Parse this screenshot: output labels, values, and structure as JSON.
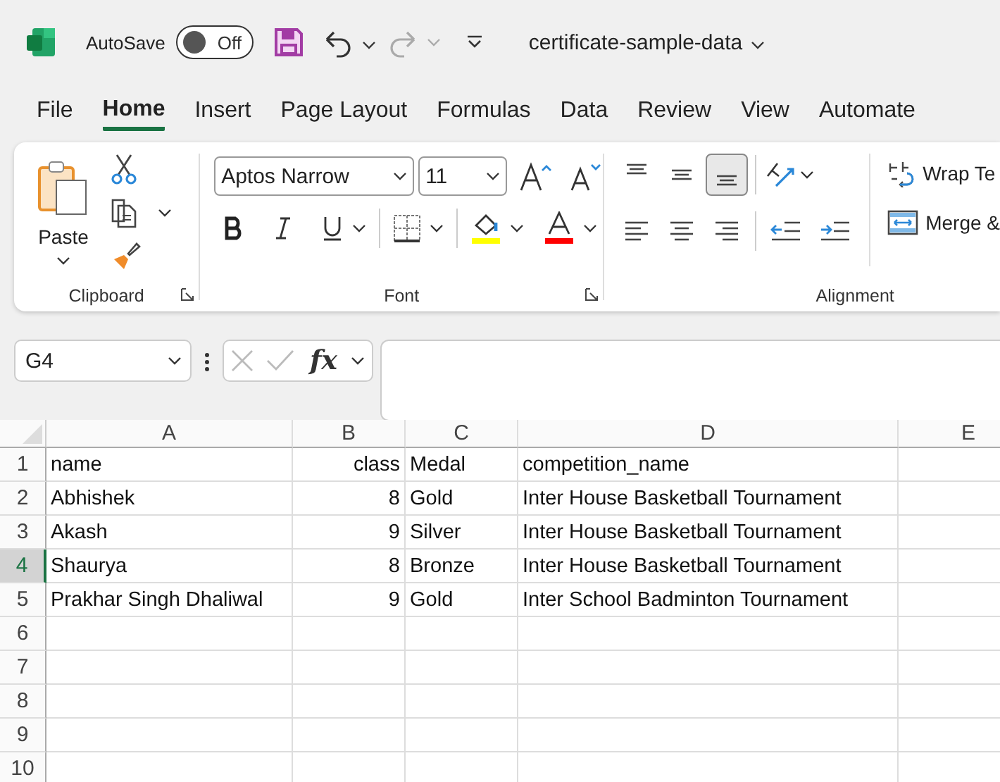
{
  "title_bar": {
    "autosave": {
      "label": "AutoSave",
      "on": false,
      "state_label": "Off"
    },
    "undo": {
      "disabled": false
    },
    "redo": {
      "disabled": true
    },
    "file_name": "certificate-sample-data"
  },
  "tabs": [
    {
      "label": "File",
      "selected": false
    },
    {
      "label": "Home",
      "selected": true
    },
    {
      "label": "Insert",
      "selected": false
    },
    {
      "label": "Page Layout",
      "selected": false
    },
    {
      "label": "Formulas",
      "selected": false
    },
    {
      "label": "Data",
      "selected": false
    },
    {
      "label": "Review",
      "selected": false
    },
    {
      "label": "View",
      "selected": false
    },
    {
      "label": "Automate",
      "selected": false
    }
  ],
  "ribbon": {
    "clipboard": {
      "paste_label": "Paste",
      "name": "Clipboard"
    },
    "font": {
      "font_name": "Aptos Narrow",
      "font_size": "11",
      "name": "Font"
    },
    "alignment": {
      "vertical_buttons": [
        {
          "kind": "top",
          "selected": false
        },
        {
          "kind": "middle",
          "selected": false
        },
        {
          "kind": "bottom",
          "selected": true
        }
      ],
      "horizontal_buttons": [
        {
          "kind": "left",
          "selected": false
        },
        {
          "kind": "center",
          "selected": false
        },
        {
          "kind": "right",
          "selected": false
        }
      ],
      "wrap_label": "Wrap Te",
      "merge_label": "Merge &",
      "name": "Alignment"
    }
  },
  "formula_bar": {
    "name_box": "G4",
    "function_label": "fx"
  },
  "sheet": {
    "columns": [
      {
        "label": "A",
        "kind": "text"
      },
      {
        "label": "B",
        "kind": "number"
      },
      {
        "label": "C",
        "kind": "text"
      },
      {
        "label": "D",
        "kind": "text"
      },
      {
        "label": "E"
      }
    ],
    "rows": [
      {
        "number": "1",
        "selected": false,
        "cells": [
          "name",
          "class",
          "Medal",
          "competition_name"
        ]
      },
      {
        "number": "2",
        "selected": false,
        "cells": [
          "Abhishek",
          "8",
          "Gold",
          "Inter House Basketball Tournament"
        ]
      },
      {
        "number": "3",
        "selected": false,
        "cells": [
          "Akash",
          "9",
          "Silver",
          "Inter House Basketball Tournament"
        ]
      },
      {
        "number": "4",
        "selected": true,
        "cells": [
          "Shaurya",
          "8",
          "Bronze",
          "Inter House Basketball Tournament"
        ]
      },
      {
        "number": "5",
        "selected": false,
        "cells": [
          "Prakhar Singh Dhaliwal",
          "9",
          "Gold",
          "Inter School Badminton Tournament"
        ]
      },
      {
        "number": "6",
        "selected": false,
        "cells": []
      },
      {
        "number": "7",
        "selected": false,
        "cells": []
      },
      {
        "number": "8",
        "selected": false,
        "cells": []
      },
      {
        "number": "9",
        "selected": false,
        "cells": []
      },
      {
        "number": "10",
        "selected": false,
        "cells": []
      }
    ]
  }
}
